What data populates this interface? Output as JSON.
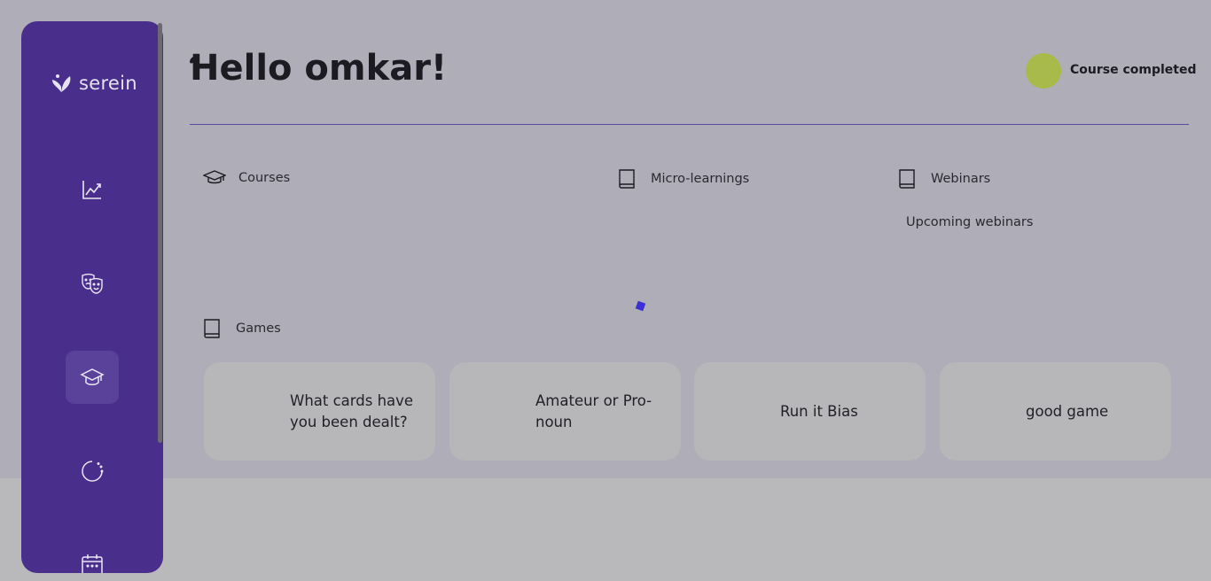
{
  "app": {
    "logo_text": "serein"
  },
  "sidebar": {
    "items": [
      {
        "icon": "chart-line-icon"
      },
      {
        "icon": "theater-masks-icon"
      },
      {
        "icon": "graduation-cap-icon",
        "active": true
      },
      {
        "icon": "loading-circle-icon"
      },
      {
        "icon": "calendar-icon"
      }
    ]
  },
  "header": {
    "greeting": "Hello omkar!",
    "status_text": "Course completed",
    "avatar_color": "#a8ba4a"
  },
  "sections": {
    "courses": {
      "label": "Courses",
      "icon": "graduation-cap-icon"
    },
    "micro_learnings": {
      "label": "Micro-learnings",
      "icon": "book-icon"
    },
    "webinars": {
      "label": "Webinars",
      "icon": "book-icon",
      "sub_label": "Upcoming webinars"
    },
    "games": {
      "label": "Games",
      "icon": "book-icon",
      "cards": [
        {
          "title": "What cards have you been dealt?"
        },
        {
          "title": "Amateur or Pro-noun"
        },
        {
          "title": "Run it Bias"
        },
        {
          "title": "good game"
        }
      ]
    }
  },
  "colors": {
    "sidebar": "#4a2e8c",
    "page_background": "#afadb8",
    "accent": "#5a4ba0"
  }
}
